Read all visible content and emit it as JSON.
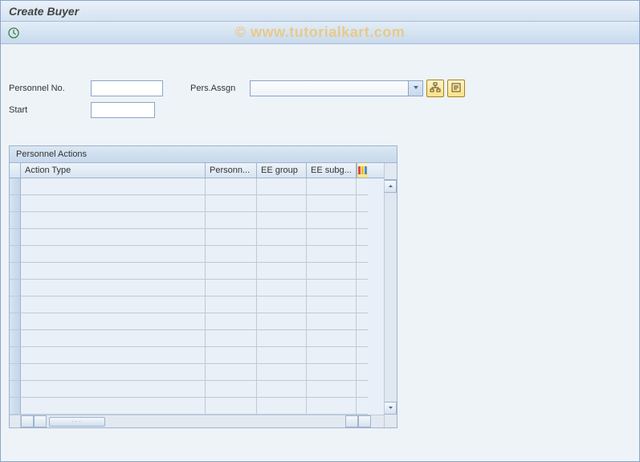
{
  "title": "Create Buyer",
  "watermark": "© www.tutorialkart.com",
  "form": {
    "personnel_no_label": "Personnel No.",
    "personnel_no_value": "",
    "start_label": "Start",
    "start_value": "",
    "pers_assgn_label": "Pers.Assgn",
    "pers_assgn_value": ""
  },
  "icons": {
    "execute": "clock-icon",
    "org_assignment": "org-tree-icon",
    "display_details": "details-icon",
    "dropdown": "chevron-down-icon",
    "config": "table-config-icon",
    "scroll_up": "arrow-up-icon",
    "scroll_down": "arrow-down-icon",
    "scroll_left": "arrow-left-icon",
    "scroll_right": "arrow-right-icon"
  },
  "section": {
    "title": "Personnel Actions",
    "columns": [
      "Action Type",
      "Personn...",
      "EE group",
      "EE subg..."
    ],
    "row_count": 14
  }
}
